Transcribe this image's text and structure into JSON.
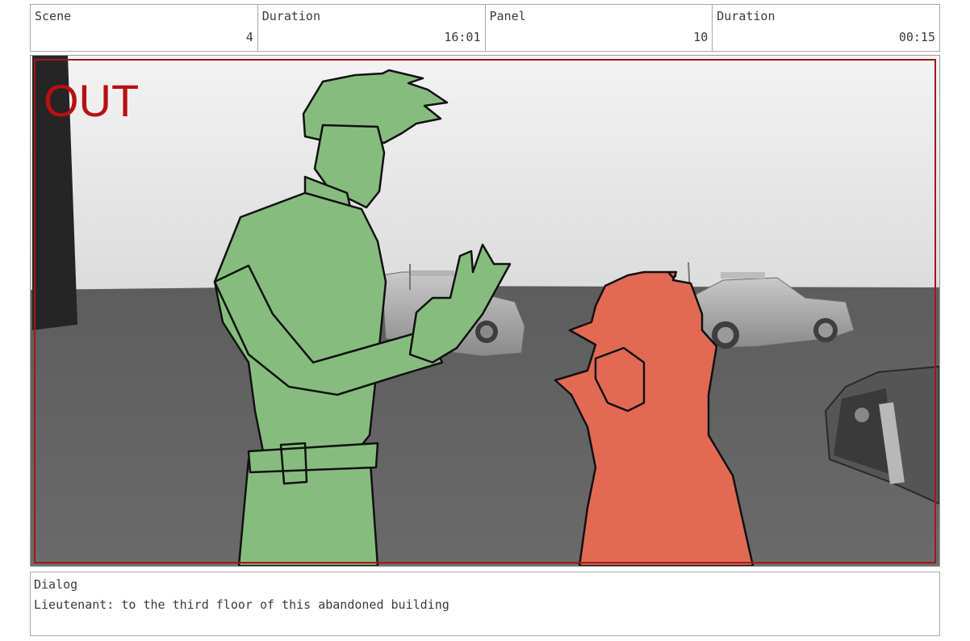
{
  "header": {
    "cells": [
      {
        "label": "Scene",
        "value": "4"
      },
      {
        "label": "Duration",
        "value": "16:01"
      },
      {
        "label": "Panel",
        "value": "10"
      },
      {
        "label": "Duration",
        "value": "00:15"
      }
    ]
  },
  "panel": {
    "overlay_text": "OUT",
    "colors": {
      "safe_frame": "#a01818",
      "character_left": "#86bd7e",
      "character_right": "#e26a55",
      "ground": "#626262",
      "sky": "#ececec"
    }
  },
  "dialog": {
    "label": "Dialog",
    "text": "Lieutenant: to the third floor of this abandoned building"
  }
}
